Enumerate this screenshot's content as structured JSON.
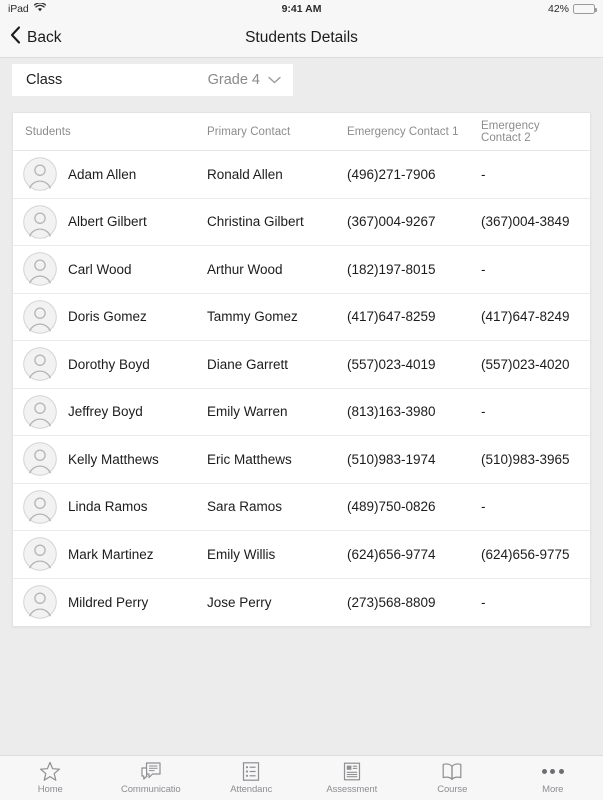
{
  "status_bar": {
    "device": "iPad",
    "wifi_icon": "wifi-icon",
    "time": "9:41 AM",
    "battery_percent": "42%",
    "battery_level": 42,
    "battery_color": "#4cd964"
  },
  "nav_bar": {
    "back_icon": "chevron-left-icon",
    "back_label": "Back",
    "title": "Students Details"
  },
  "class_selector": {
    "label": "Class",
    "value": "Grade 4",
    "chevron_icon": "chevron-down-icon"
  },
  "table": {
    "columns": [
      "Students",
      "Primary Contact",
      "Emergency Contact 1",
      "Emergency Contact 2"
    ],
    "rows": [
      {
        "avatar": "person-avatar-icon",
        "student": "Adam Allen",
        "primary_contact": "Ronald Allen",
        "emergency_contact_1": "(496)271-7906",
        "emergency_contact_2": "-"
      },
      {
        "avatar": "person-avatar-icon",
        "student": "Albert Gilbert",
        "primary_contact": "Christina Gilbert",
        "emergency_contact_1": "(367)004-9267",
        "emergency_contact_2": "(367)004-3849"
      },
      {
        "avatar": "person-avatar-icon",
        "student": "Carl Wood",
        "primary_contact": "Arthur Wood",
        "emergency_contact_1": "(182)197-8015",
        "emergency_contact_2": "-"
      },
      {
        "avatar": "person-avatar-icon",
        "student": "Doris Gomez",
        "primary_contact": "Tammy Gomez",
        "emergency_contact_1": "(417)647-8259",
        "emergency_contact_2": "(417)647-8249"
      },
      {
        "avatar": "person-avatar-icon",
        "student": "Dorothy Boyd",
        "primary_contact": "Diane Garrett",
        "emergency_contact_1": "(557)023-4019",
        "emergency_contact_2": "(557)023-4020"
      },
      {
        "avatar": "person-avatar-icon",
        "student": "Jeffrey Boyd",
        "primary_contact": "Emily Warren",
        "emergency_contact_1": "(813)163-3980",
        "emergency_contact_2": "-"
      },
      {
        "avatar": "person-avatar-icon",
        "student": "Kelly Matthews",
        "primary_contact": "Eric Matthews",
        "emergency_contact_1": "(510)983-1974",
        "emergency_contact_2": "(510)983-3965"
      },
      {
        "avatar": "person-avatar-icon",
        "student": "Linda Ramos",
        "primary_contact": "Sara Ramos",
        "emergency_contact_1": "(489)750-0826",
        "emergency_contact_2": "-"
      },
      {
        "avatar": "person-avatar-icon",
        "student": "Mark Martinez",
        "primary_contact": "Emily Willis",
        "emergency_contact_1": "(624)656-9774",
        "emergency_contact_2": "(624)656-9775"
      },
      {
        "avatar": "person-avatar-icon",
        "student": "Mildred Perry",
        "primary_contact": "Jose Perry",
        "emergency_contact_1": "(273)568-8809",
        "emergency_contact_2": "-"
      }
    ]
  },
  "tab_bar": {
    "items": [
      {
        "label": "Home",
        "icon": "star-icon"
      },
      {
        "label": "Communicatio",
        "icon": "chat-bubbles-icon"
      },
      {
        "label": "Attendanc",
        "icon": "checklist-icon"
      },
      {
        "label": "Assessment",
        "icon": "report-card-icon"
      },
      {
        "label": "Course",
        "icon": "book-icon"
      },
      {
        "label": "More",
        "icon": "ellipsis-icon"
      }
    ]
  },
  "colors": {
    "page_background": "#ececec",
    "bar_background": "#f7f7f7",
    "card_background": "#ffffff",
    "text_primary": "#1c1c1c",
    "text_secondary": "#8c8c8c",
    "tab_inactive": "#8e8e93"
  }
}
